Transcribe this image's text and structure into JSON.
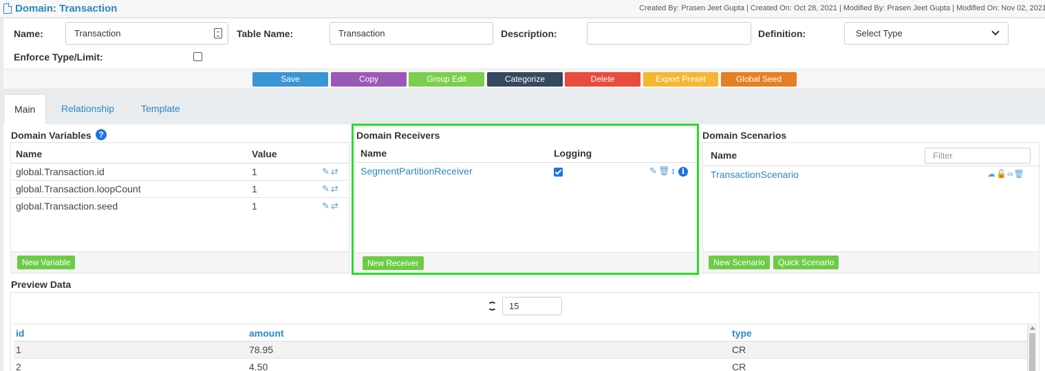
{
  "header": {
    "title": "Domain: Transaction",
    "meta": "Created By: Prasen Jeet Gupta | Created On: Oct 28, 2021 | Modified By: Prasen Jeet Gupta | Modified On: Nov 02, 2021"
  },
  "form": {
    "name_label": "Name:",
    "name_value": "Transaction",
    "table_name_label": "Table Name:",
    "table_name_value": "Transaction",
    "description_label": "Description:",
    "description_value": "",
    "definition_label": "Definition:",
    "definition_value": "Select Type",
    "enforce_label": "Enforce Type/Limit:",
    "enforce_checked": false
  },
  "buttons": [
    {
      "label": "Save",
      "color": "#3a95d6"
    },
    {
      "label": "Copy",
      "color": "#9b59b6"
    },
    {
      "label": "Group Edit",
      "color": "#7ad04c"
    },
    {
      "label": "Categorize",
      "color": "#34495e"
    },
    {
      "label": "Delete",
      "color": "#e74c3c"
    },
    {
      "label": "Export Preset",
      "color": "#f5b731"
    },
    {
      "label": "Global Seed",
      "color": "#e67e22"
    }
  ],
  "tabs": [
    {
      "label": "Main",
      "active": true
    },
    {
      "label": "Relationship",
      "active": false
    },
    {
      "label": "Template",
      "active": false
    }
  ],
  "variables": {
    "title": "Domain Variables",
    "col_name": "Name",
    "col_value": "Value",
    "rows": [
      {
        "name": "global.Transaction.id",
        "value": "1"
      },
      {
        "name": "global.Transaction.loopCount",
        "value": "1"
      },
      {
        "name": "global.Transaction.seed",
        "value": "1"
      }
    ],
    "new_button": "New Variable"
  },
  "receivers": {
    "title": "Domain Receivers",
    "col_name": "Name",
    "col_logging": "Logging",
    "rows": [
      {
        "name": "SegmentPartitionReceiver",
        "logging": true
      }
    ],
    "new_button": "New Receiver"
  },
  "scenarios": {
    "title": "Domain Scenarios",
    "col_name": "Name",
    "filter_placeholder": "Filter",
    "rows": [
      {
        "name": "TransactionScenario"
      }
    ],
    "new_button": "New Scenario",
    "quick_button": "Quick Scenario"
  },
  "preview": {
    "title": "Preview Data",
    "count": "15",
    "columns": [
      "id",
      "amount",
      "type"
    ],
    "rows": [
      [
        "1",
        "78.95",
        "CR"
      ],
      [
        "2",
        "4.50",
        "CR"
      ]
    ]
  },
  "colors": {
    "accent": "#2a87c8",
    "highlight": "#22e022",
    "green_button": "#6ccc46"
  }
}
